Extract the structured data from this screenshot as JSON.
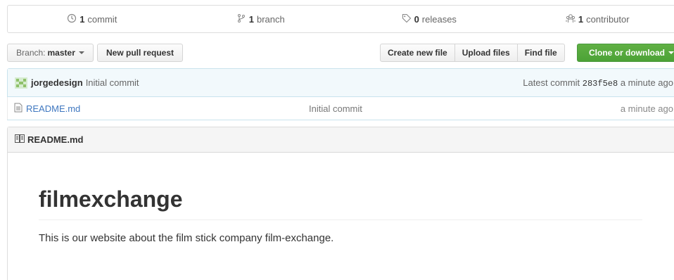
{
  "summary": {
    "commits": {
      "count": "1",
      "label": "commit"
    },
    "branches": {
      "count": "1",
      "label": "branch"
    },
    "releases": {
      "count": "0",
      "label": "releases"
    },
    "contributors": {
      "count": "1",
      "label": "contributor"
    }
  },
  "toolbar": {
    "branch_prefix": "Branch:",
    "branch_name": "master",
    "new_pr": "New pull request",
    "create_file": "Create new file",
    "upload_files": "Upload files",
    "find_file": "Find file",
    "clone": "Clone or download"
  },
  "commit": {
    "author": "jorgedesign",
    "message": "Initial commit",
    "latest_label": "Latest commit",
    "sha": "283f5e8",
    "age": "a minute ago"
  },
  "files": [
    {
      "name": "README.md",
      "message": "Initial commit",
      "age": "a minute ago"
    }
  ],
  "readme": {
    "header": "README.md",
    "title": "filmexchange",
    "body": "This is our website about the film stick company film-exchange."
  },
  "colors": {
    "link": "#4078c0",
    "clone_green": "#55a532",
    "commit_bg": "#f2f9fc"
  }
}
